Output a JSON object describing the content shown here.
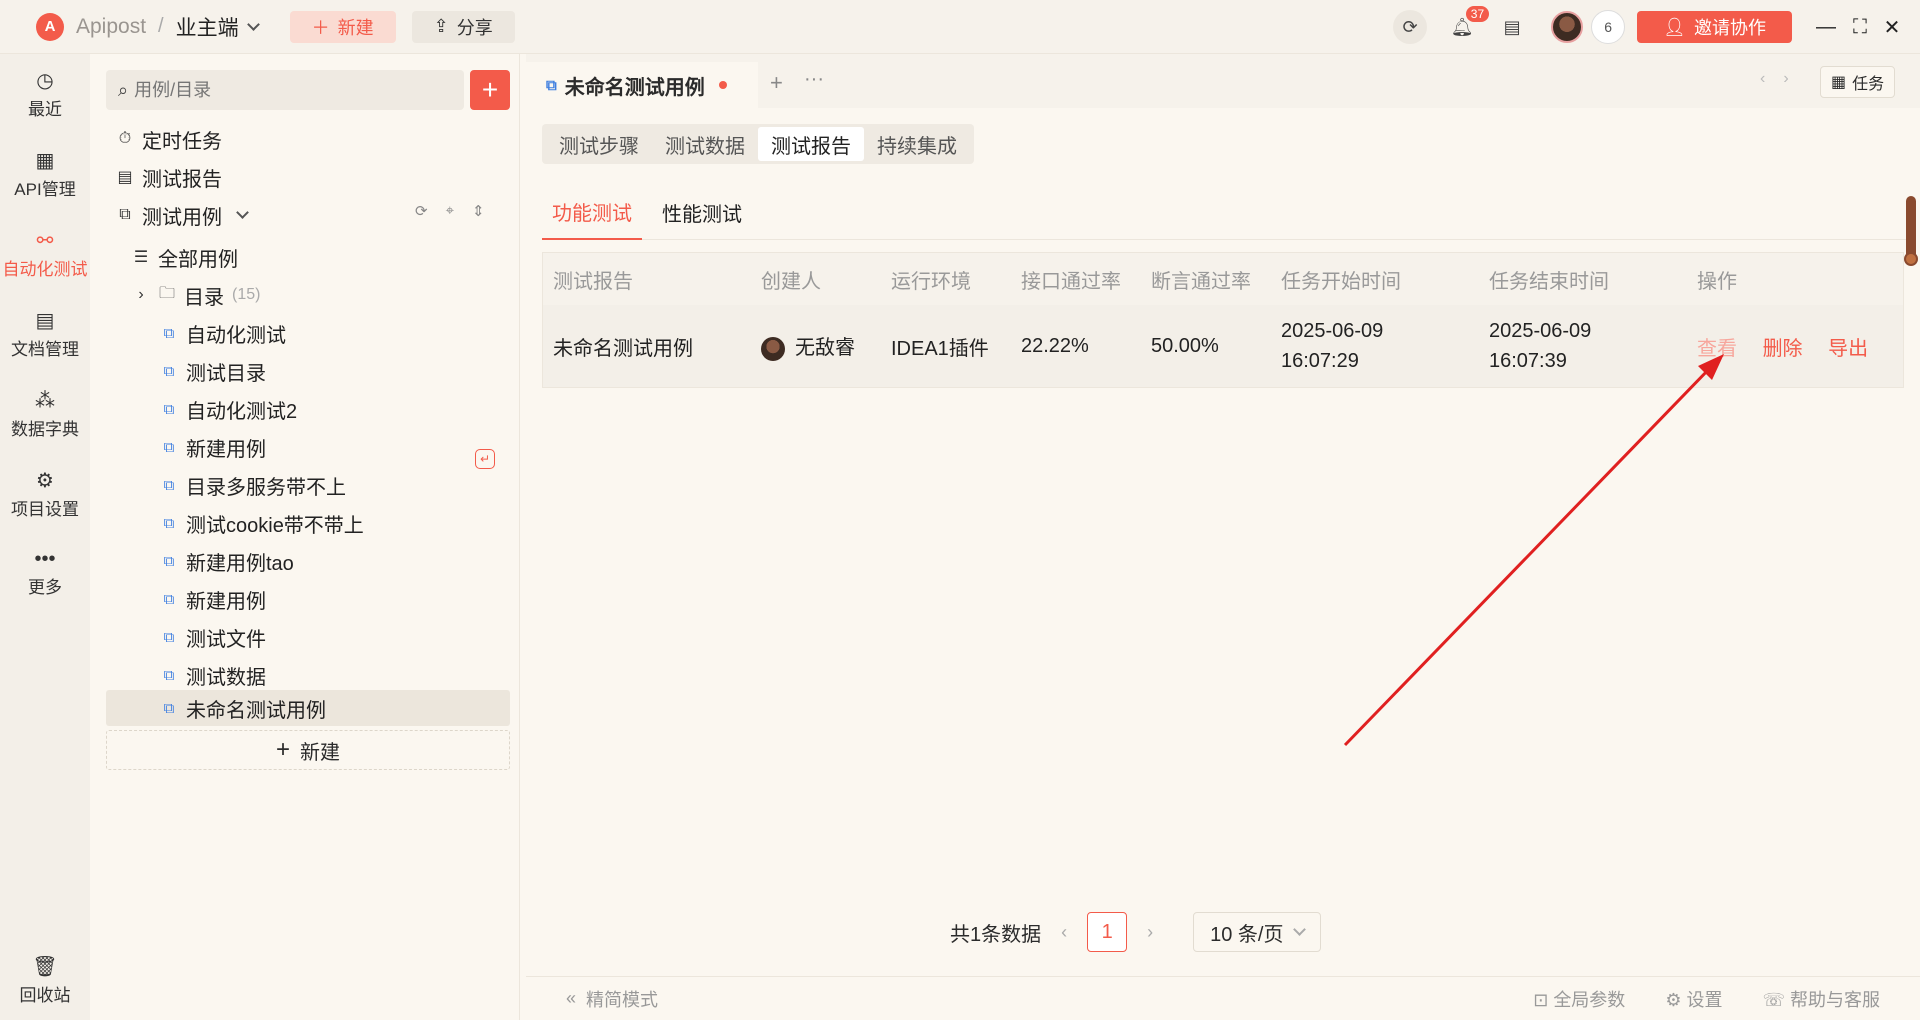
{
  "topbar": {
    "logo_letter": "A",
    "brand": "Apipost",
    "separator": "/",
    "project": "业主端",
    "new_label": "新建",
    "share_label": "分享",
    "notification_count": "37",
    "member_count": "6",
    "invite_label": "邀请协作"
  },
  "leftnav": {
    "items": [
      {
        "label": "最近",
        "icon": "history-icon"
      },
      {
        "label": "API管理",
        "icon": "api-icon"
      },
      {
        "label": "自动化测试",
        "icon": "automation-icon"
      },
      {
        "label": "文档管理",
        "icon": "document-icon"
      },
      {
        "label": "数据字典",
        "icon": "dictionary-icon"
      },
      {
        "label": "项目设置",
        "icon": "settings-icon"
      },
      {
        "label": "更多",
        "icon": "more-icon"
      }
    ],
    "recycle_label": "回收站"
  },
  "sidebar": {
    "search_placeholder": "用例/目录",
    "scheduled_tasks": "定时任务",
    "test_reports": "测试报告",
    "test_cases": "测试用例",
    "all_cases": "全部用例",
    "directory": "目录",
    "directory_count": "(15)",
    "cases": [
      "自动化测试",
      "测试目录",
      "自动化测试2",
      "新建用例",
      "目录多服务带不上",
      "测试cookie带不带上",
      "新建用例tao",
      "新建用例",
      "测试文件",
      "测试数据",
      "未命名测试用例"
    ],
    "new_label": "新建"
  },
  "main": {
    "file_tab": "未命名测试用例",
    "task_label": "任务",
    "segments": [
      "测试步骤",
      "测试数据",
      "测试报告",
      "持续集成"
    ],
    "subtabs": [
      "功能测试",
      "性能测试"
    ],
    "table": {
      "headers": [
        "测试报告",
        "创建人",
        "运行环境",
        "接口通过率",
        "断言通过率",
        "任务开始时间",
        "任务结束时间",
        "操作"
      ],
      "row": {
        "name": "未命名测试用例",
        "creator": "无敌睿",
        "env": "IDEA1插件",
        "api_rate": "22.22%",
        "assert_rate": "50.00%",
        "start_date": "2025-06-09",
        "start_time": "16:07:29",
        "end_date": "2025-06-09",
        "end_time": "16:07:39",
        "op_view": "查看",
        "op_delete": "删除",
        "op_export": "导出"
      }
    },
    "pager": {
      "total": "共1条数据",
      "current": "1",
      "page_size": "10 条/页"
    }
  },
  "footer": {
    "simple_mode": "精简模式",
    "global_params": "全局参数",
    "settings": "设置",
    "help": "帮助与客服"
  },
  "colors": {
    "accent": "#f35b4a",
    "annotation_arrow": "#e02020"
  }
}
